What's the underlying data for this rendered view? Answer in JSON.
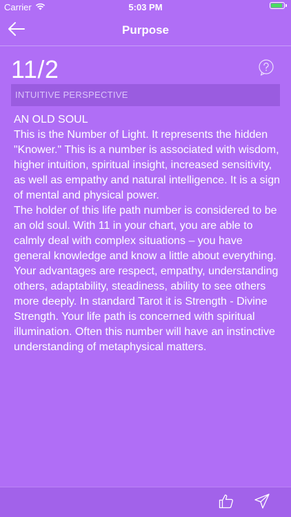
{
  "status_bar": {
    "carrier": "Carrier",
    "time": "5:03 PM",
    "wifi_icon": "wifi-icon",
    "battery_icon": "battery-icon"
  },
  "nav": {
    "title": "Purpose",
    "back_icon": "back-arrow-icon"
  },
  "header": {
    "number": "11/2",
    "help_icon": "help-icon",
    "section_label": "INTUITIVE PERSPECTIVE"
  },
  "content": {
    "heading": "AN OLD SOUL",
    "paragraphs": [
      "This is the Number of Light. It represents the hidden \"Knower.\" This is a number is associated with wisdom, higher intuition, spiritual insight, increased sensitivity, as well as empathy and natural intelligence. It is a sign of mental and physical power.",
      "The holder of this life path number is considered to be an old soul. With 11 in your chart, you are able to calmly deal with complex situations – you have general knowledge and know a little about everything.",
      "Your advantages are respect, empathy, understanding others, adaptability, steadiness, ability to see others more deeply. In standard Tarot it is Strength - Divine Strength. Your life path is concerned with spiritual illumination. Often this number will have an instinctive understanding of metaphysical matters."
    ]
  },
  "toolbar": {
    "like_icon": "thumbs-up-icon",
    "share_icon": "share-icon"
  },
  "colors": {
    "background": "#b06ef6",
    "banner": "#9a5ce0",
    "toolbar": "#a262ea",
    "battery": "#4cd964"
  }
}
